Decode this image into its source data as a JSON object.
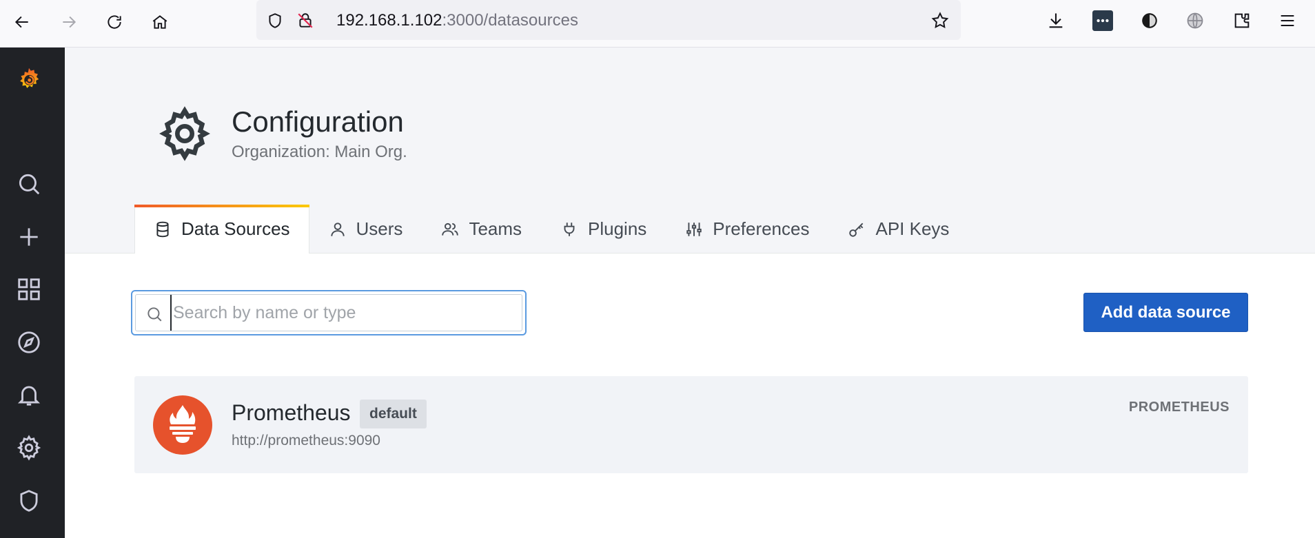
{
  "browser": {
    "url_host": "192.168.1.102",
    "url_path": ":3000/datasources",
    "icons": [
      "back-arrow-icon",
      "forward-arrow-icon",
      "reload-icon",
      "home-icon",
      "shield-icon",
      "insecure-lock-icon",
      "bookmark-star-icon",
      "download-icon",
      "password-manager-icon",
      "dark-reader-icon",
      "globe-icon",
      "extensions-icon",
      "hamburger-menu-icon"
    ]
  },
  "sidebar": {
    "items": [
      "grafana-logo",
      "search-icon",
      "create-plus-icon",
      "dashboards-grid-icon",
      "explore-compass-icon",
      "alerting-bell-icon",
      "configuration-gear-icon",
      "server-admin-shield-icon"
    ]
  },
  "header": {
    "title": "Configuration",
    "subtitle": "Organization: Main Org."
  },
  "tabs": [
    {
      "label": "Data Sources",
      "icon": "database-icon",
      "active": true
    },
    {
      "label": "Users",
      "icon": "user-icon",
      "active": false
    },
    {
      "label": "Teams",
      "icon": "users-icon",
      "active": false
    },
    {
      "label": "Plugins",
      "icon": "plug-icon",
      "active": false
    },
    {
      "label": "Preferences",
      "icon": "sliders-icon",
      "active": false
    },
    {
      "label": "API Keys",
      "icon": "key-icon",
      "active": false
    }
  ],
  "search": {
    "placeholder": "Search by name or type",
    "value": ""
  },
  "actions": {
    "add_label": "Add data source"
  },
  "datasources": [
    {
      "name": "Prometheus",
      "badge": "default",
      "url": "http://prometheus:9090",
      "type": "PROMETHEUS"
    }
  ],
  "colors": {
    "primary_button": "#1f60c4",
    "sidebar_bg": "#202226",
    "tab_accent_start": "#f05a28",
    "tab_accent_end": "#fbca0a",
    "prometheus_logo": "#e6522c"
  }
}
